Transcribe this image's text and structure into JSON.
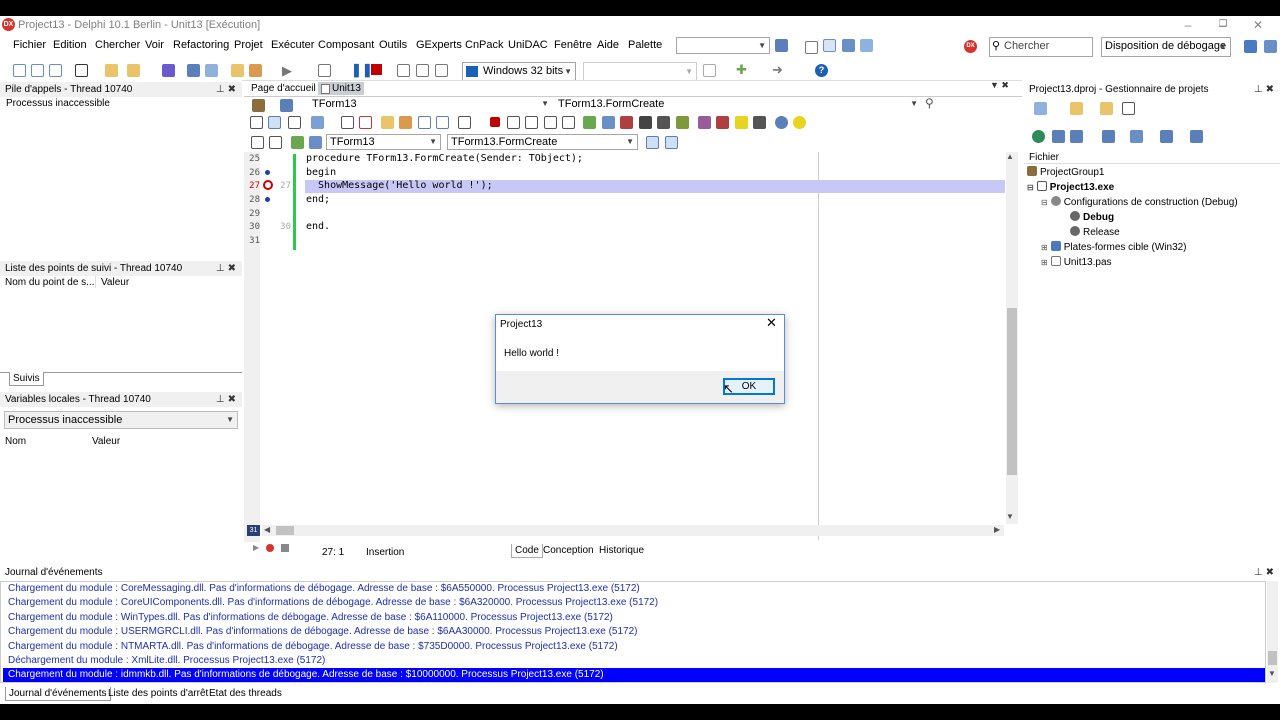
{
  "window": {
    "title": "Project13 - Delphi 10.1 Berlin - Unit13 [Exécution]",
    "logo": "DX",
    "controls": [
      "–",
      "❐",
      "✕"
    ]
  },
  "menu": [
    "Fichier",
    "Edition",
    "Chercher",
    "Voir",
    "Refactoring",
    "Projet",
    "Exécuter",
    "Composant",
    "Outils",
    "GExperts",
    "CnPack",
    "UniDAC",
    "Fenêtre",
    "Aide",
    "Palette"
  ],
  "toolbar": {
    "search_placeholder": "Chercher",
    "layout": "Disposition de débogage",
    "platform": "Windows 32 bits",
    "dx_badge": "DX"
  },
  "call_stack": {
    "title": "Pile d'appels - Thread 10740",
    "status": "Processus inaccessible"
  },
  "watch_list": {
    "title": "Liste des points de suivi - Thread 10740",
    "col_name": "Nom du point de s...",
    "col_value": "Valeur",
    "tab": "Suivis"
  },
  "locals": {
    "title": "Variables locales - Thread 10740",
    "selected": "Processus inaccessible",
    "col_name": "Nom",
    "col_value": "Valeur"
  },
  "editor": {
    "tab_home": "Page d'accueil",
    "tab_unit": "Unit13",
    "class_combo": "TForm13",
    "method_combo": "TForm13.FormCreate",
    "class_combo2": "TForm13",
    "method_combo2": "TForm13.FormCreate",
    "lines": [
      {
        "num": "25",
        "code": "procedure TForm13.FormCreate(Sender: TObject);"
      },
      {
        "num": "26",
        "code": "begin"
      },
      {
        "num": "27",
        "code": "  ShowMessage('Hello world !');",
        "sub": "27"
      },
      {
        "num": "28",
        "code": "end;"
      },
      {
        "num": "29",
        "code": ""
      },
      {
        "num": "30",
        "code": "end.",
        "sub": "30"
      },
      {
        "num": "31",
        "code": ""
      }
    ],
    "line_indicator": "31",
    "position": "27:   1",
    "mode": "Insertion",
    "bottom_tabs": [
      "Code",
      "Conception",
      "Historique"
    ]
  },
  "dialog": {
    "title": "Project13",
    "message": "Hello world !",
    "ok": "OK"
  },
  "project_manager": {
    "title": "Project13.dproj - Gestionnaire de projets",
    "header": "Fichier",
    "items": [
      {
        "label": "ProjectGroup1"
      },
      {
        "label": "Project13.exe"
      },
      {
        "label": "Configurations de construction (Debug)"
      },
      {
        "label": "Debug"
      },
      {
        "label": "Release"
      },
      {
        "label": "Plates-formes cible (Win32)"
      },
      {
        "label": "Unit13.pas"
      }
    ]
  },
  "event_log": {
    "title": "Journal d'événements",
    "lines": [
      "Chargement du module : CoreMessaging.dll. Pas d'informations de débogage. Adresse de base : $6A550000. Processus Project13.exe (5172)",
      "Chargement du module : CoreUIComponents.dll. Pas d'informations de débogage. Adresse de base : $6A320000. Processus Project13.exe (5172)",
      "Chargement du module : WinTypes.dll. Pas d'informations de débogage. Adresse de base : $6A110000. Processus Project13.exe (5172)",
      "Chargement du module : USERMGRCLI.dll. Pas d'informations de débogage. Adresse de base : $6AA30000. Processus Project13.exe (5172)",
      "Chargement du module : NTMARTA.dll. Pas d'informations de débogage. Adresse de base : $735D0000. Processus Project13.exe (5172)",
      "Déchargement du module : XmlLite.dll. Processus Project13.exe (5172)",
      "Chargement du module : idmmkb.dll. Pas d'informations de débogage. Adresse de base : $10000000. Processus Project13.exe (5172)"
    ],
    "tabs": [
      "Journal d'événements",
      "Liste des points d'arrêt",
      "Etat des threads"
    ]
  },
  "colors": {
    "accent": "#0078d7",
    "selection": "#0000ff",
    "exec_line": "#c8c8f8",
    "log_text": "#1f2fb3"
  }
}
